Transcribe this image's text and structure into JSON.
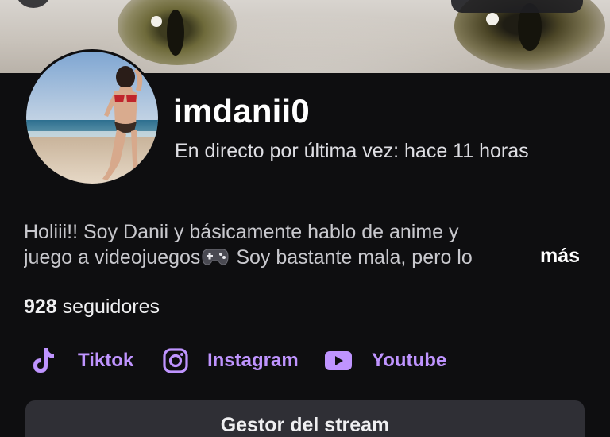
{
  "channel": {
    "username": "imdanii0",
    "last_live": "En directo por última vez: hace 11 horas",
    "bio_line1": "Holiii!! Soy Danii y básicamente hablo de anime y",
    "bio_line2_start": "juego a videojuegos",
    "bio_emoji": "🎮",
    "bio_line2_end": " Soy bastante mala, pero lo",
    "bio_more": "más",
    "followers_count": "928",
    "followers_label": " seguidores"
  },
  "socials": [
    {
      "name": "Tiktok",
      "icon": "tiktok-icon"
    },
    {
      "name": "Instagram",
      "icon": "instagram-icon"
    },
    {
      "name": "Youtube",
      "icon": "youtube-icon"
    }
  ],
  "actions": {
    "stream_manager": "Gestor del stream"
  },
  "colors": {
    "background": "#0e0e10",
    "accent": "#bf94ff",
    "button": "#2f2f35"
  }
}
